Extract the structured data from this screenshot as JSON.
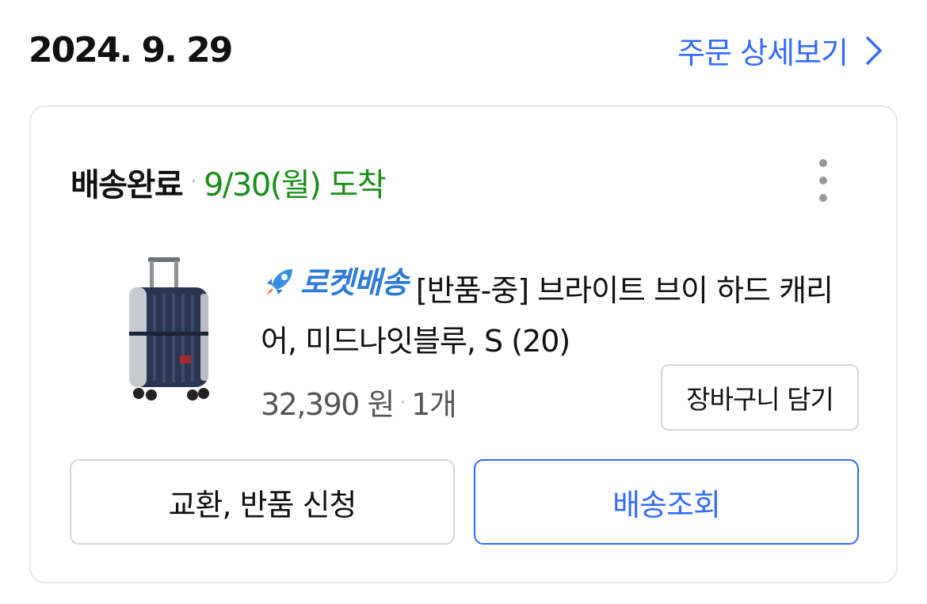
{
  "header": {
    "order_date": "2024. 9. 29",
    "detail_link": "주문 상세보기"
  },
  "order": {
    "status": "배송완료",
    "arrival": "9/30(월) 도착",
    "product": {
      "badge": "로켓배송",
      "title": "[반품-중] 브라이트 브이 하드 캐리어, 미드나잇블루, S (20)",
      "price": "32,390 원",
      "quantity": "1개"
    },
    "cart_button": "장바구니 담기",
    "return_button": "교환, 반품 신청",
    "track_button": "배송조회"
  },
  "colors": {
    "accent": "#346aff",
    "arrival_green": "#1a8e1a",
    "rocket_blue": "#2d7ad9"
  },
  "icons": {
    "detail_link": "chevron-right-icon",
    "menu": "kebab-menu-icon",
    "badge": "rocket-icon"
  }
}
